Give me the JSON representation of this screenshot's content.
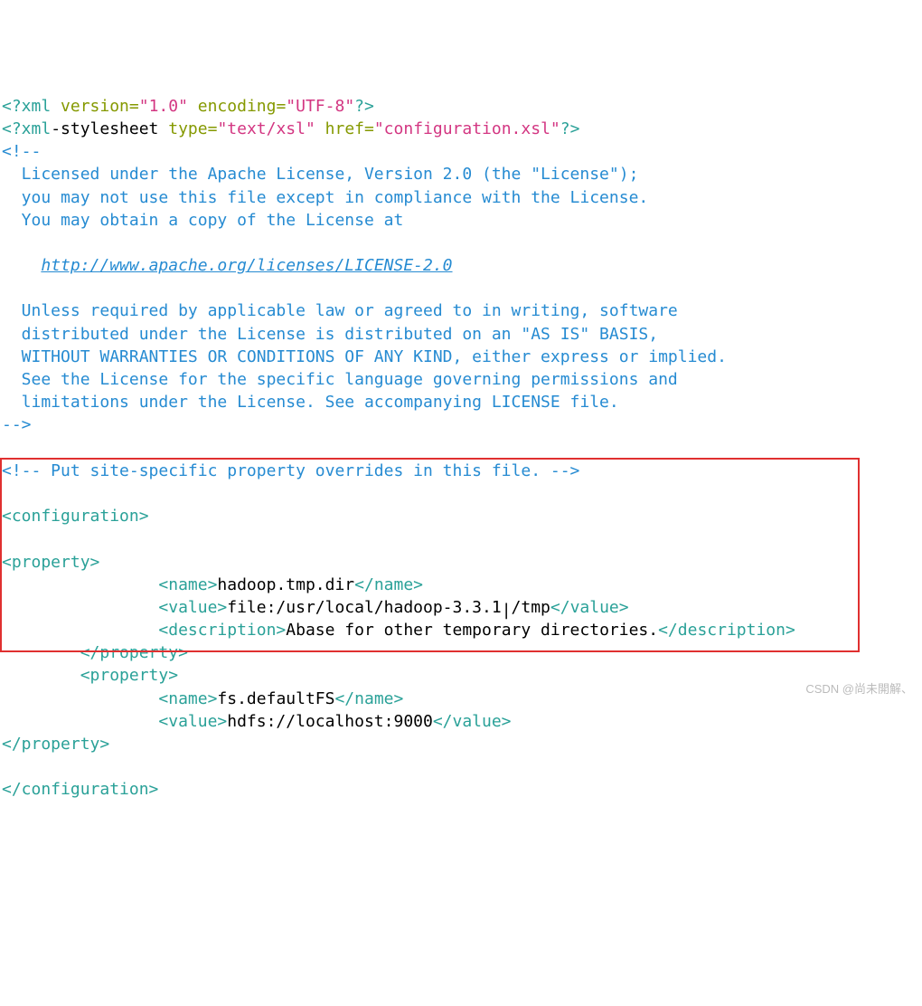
{
  "xml_decl": {
    "open": "<?xml",
    "attrs": " version=",
    "version": "\"1.0\"",
    "enc_attr": " encoding=",
    "encoding": "\"UTF-8\"",
    "close": "?>"
  },
  "stylesheet": {
    "open": "<?xml",
    "dash": "-stylesheet",
    "type_attr": " type=",
    "type_val": "\"text/xsl\"",
    "href_attr": " href=",
    "href_val": "\"configuration.xsl\"",
    "close": "?>"
  },
  "comment_open": "<!--",
  "license": {
    "l1": "  Licensed under the Apache License, Version 2.0 (the \"License\");",
    "l2": "  you may not use this file except in compliance with the License.",
    "l3": "  You may obtain a copy of the License at",
    "link_indent": "    ",
    "link": "http://www.apache.org/licenses/LICENSE-2.0",
    "l5": "  Unless required by applicable law or agreed to in writing, software",
    "l6": "  distributed under the License is distributed on an \"AS IS\" BASIS,",
    "l7": "  WITHOUT WARRANTIES OR CONDITIONS OF ANY KIND, either express or implied.",
    "l8": "  See the License for the specific language governing permissions and",
    "l9": "  limitations under the License. See accompanying LICENSE file."
  },
  "comment_close": "-->",
  "comment2": "<!-- Put site-specific property overrides in this file. -->",
  "tags": {
    "configuration_open": "<configuration>",
    "configuration_close": "</configuration>",
    "property_open": "<property>",
    "property_close": "</property>",
    "name_open": "<name>",
    "name_close": "</name>",
    "value_open": "<value>",
    "value_close": "</value>",
    "description_open": "<description>",
    "description_close": "</description>"
  },
  "prop1": {
    "name": "hadoop.tmp.dir",
    "value_a": "file:/usr/local/hadoop-3.3.1",
    "value_b": "/tmp",
    "description": "Abase for other temporary directories."
  },
  "prop2": {
    "name": "fs.defaultFS",
    "value": "hdfs://localhost:9000"
  },
  "indent8": "        ",
  "indent12": "            ",
  "indent16": "                ",
  "footer": "CSDN @尚未開解、"
}
